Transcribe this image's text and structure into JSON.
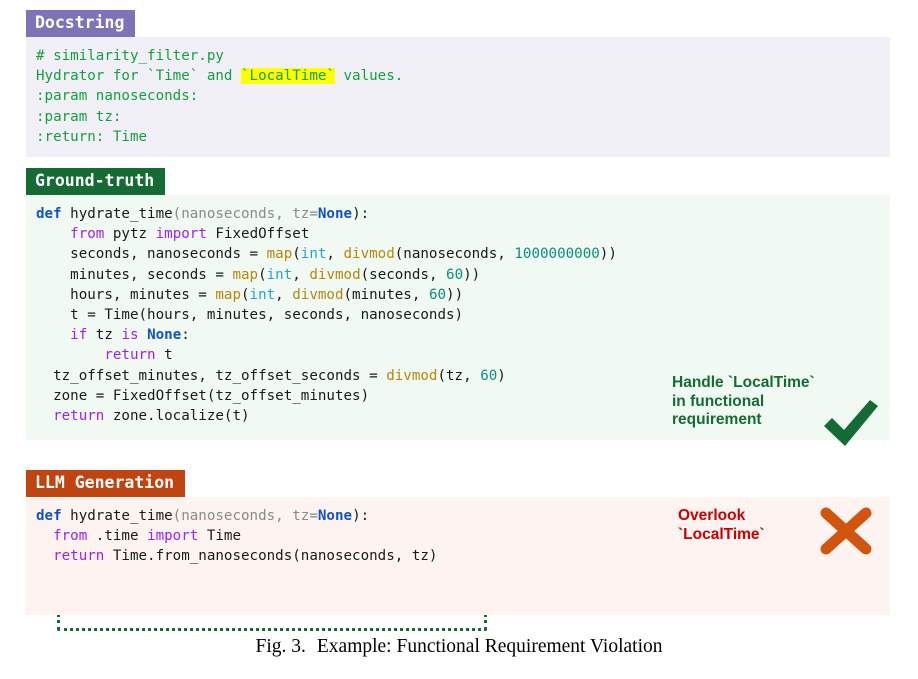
{
  "figure": {
    "caption_label": "Fig. 3.",
    "caption_text": "Example: Functional Requirement Violation"
  },
  "colors": {
    "docstring_tab": "#7e72b8",
    "docstring_bg": "#f1f0f7",
    "docstring_text": "#13a03c",
    "highlight": "#ffff00",
    "ground_truth_tab": "#146b34",
    "ground_truth_bg": "#f0faf3",
    "llm_tab": "#c0440f",
    "llm_bg": "#fdf3f1",
    "check_mark": "#146b34",
    "cross_mark": "#d2550f",
    "annotation_red": "#cc0000"
  },
  "panels": {
    "docstring": {
      "tab_label": "Docstring",
      "lines": [
        "# similarity_filter.py",
        "Hydrator for `Time` and `LocalTime` values.",
        ":param nanoseconds:",
        ":param tz:",
        ":return: Time"
      ],
      "highlighted_token": "`LocalTime`",
      "line2_prefix": "Hydrator for `Time` and ",
      "line2_suffix": " values."
    },
    "ground_truth": {
      "tab_label": "Ground-truth",
      "code_lines": [
        "def hydrate_time(nanoseconds, tz=None):",
        "    from pytz import FixedOffset",
        "    seconds, nanoseconds = map(int, divmod(nanoseconds, 1000000000))",
        "    minutes, seconds = map(int, divmod(seconds, 60))",
        "    hours, minutes = map(int, divmod(minutes, 60))",
        "    t = Time(hours, minutes, seconds, nanoseconds)",
        "    if tz is None:",
        "        return t",
        "    tz_offset_minutes, tz_offset_seconds = divmod(tz, 60)",
        "    zone = FixedOffset(tz_offset_minutes)",
        "    return zone.localize(t)"
      ],
      "tokens": {
        "def": "def",
        "func_name": "hydrate_time",
        "sig_params": "(nanoseconds, tz=",
        "none": "None",
        "sig_tail": "):",
        "from": "from",
        "import": "import",
        "module": "pytz",
        "imported": "FixedOffset",
        "map": "map",
        "int": "int",
        "divmod": "divmod",
        "nanoseconds_divisor": "1000000000",
        "sixty": "60",
        "if": "if",
        "is": "is",
        "return": "return"
      },
      "annotation": "Handle `LocalTime`\nin functional\nrequirement",
      "verdict_icon": "check-mark",
      "highlight_box_lines": [
        "    tz_offset_minutes, tz_offset_seconds = divmod(tz, 60)",
        "    zone = FixedOffset(tz_offset_minutes)",
        "    return zone.localize(t)"
      ]
    },
    "llm_generation": {
      "tab_label": "LLM Generation",
      "code_lines": [
        "def hydrate_time(nanoseconds, tz=None):",
        "  from .time import Time",
        "  return Time.from_nanoseconds(nanoseconds, tz)"
      ],
      "annotation": "Overlook\n`LocalTime`",
      "verdict_icon": "cross-mark"
    }
  }
}
